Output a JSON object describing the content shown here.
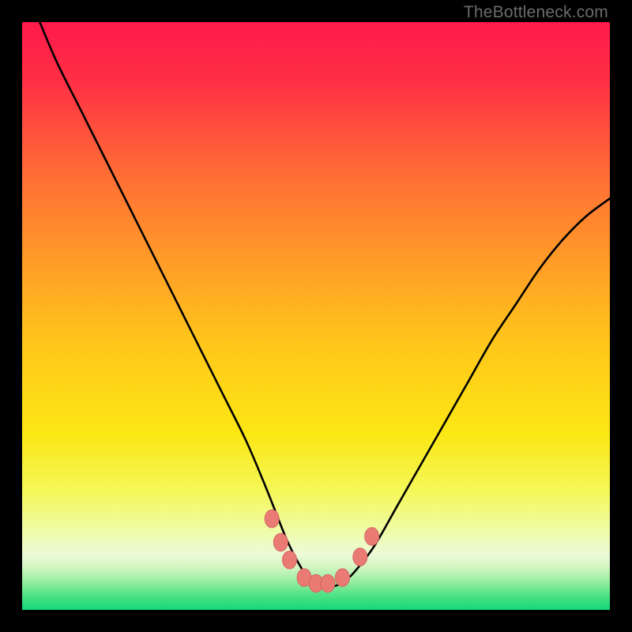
{
  "watermark": "TheBottleneck.com",
  "colors": {
    "black": "#000000",
    "curve": "#000000",
    "marker_fill": "#e97a74",
    "marker_stroke": "#d66761",
    "gradient_stops": [
      {
        "offset": 0.0,
        "color": "#ff1a4b"
      },
      {
        "offset": 0.1,
        "color": "#ff2f45"
      },
      {
        "offset": 0.25,
        "color": "#ff6a36"
      },
      {
        "offset": 0.4,
        "color": "#ff9a28"
      },
      {
        "offset": 0.55,
        "color": "#ffc71a"
      },
      {
        "offset": 0.7,
        "color": "#fbe714"
      },
      {
        "offset": 0.8,
        "color": "#f4f85a"
      },
      {
        "offset": 0.87,
        "color": "#eefcad"
      },
      {
        "offset": 0.905,
        "color": "#ecfad8"
      },
      {
        "offset": 0.925,
        "color": "#d7f6c5"
      },
      {
        "offset": 0.95,
        "color": "#9ceea4"
      },
      {
        "offset": 0.975,
        "color": "#4fe287"
      },
      {
        "offset": 1.0,
        "color": "#14d877"
      }
    ]
  },
  "chart_data": {
    "type": "line",
    "title": "",
    "xlabel": "",
    "ylabel": "",
    "xlim": [
      0,
      100
    ],
    "ylim": [
      0,
      100
    ],
    "series": [
      {
        "name": "bottleneck-curve",
        "x": [
          3,
          6,
          10,
          14,
          18,
          22,
          26,
          30,
          34,
          38,
          41,
          43,
          45,
          47,
          49,
          51,
          53,
          55,
          57,
          60,
          64,
          68,
          72,
          76,
          80,
          84,
          88,
          92,
          96,
          100
        ],
        "y": [
          100,
          93,
          85,
          77,
          69,
          61,
          53,
          45,
          37,
          29,
          22,
          17,
          12,
          8,
          5,
          4,
          4,
          5,
          7,
          11,
          18,
          25,
          32,
          39,
          46,
          52,
          58,
          63,
          67,
          70
        ]
      }
    ],
    "markers": [
      {
        "x": 42.5,
        "y": 15.5
      },
      {
        "x": 44.0,
        "y": 11.5
      },
      {
        "x": 45.5,
        "y": 8.5
      },
      {
        "x": 48.0,
        "y": 5.5
      },
      {
        "x": 50.0,
        "y": 4.5
      },
      {
        "x": 52.0,
        "y": 4.5
      },
      {
        "x": 54.5,
        "y": 5.5
      },
      {
        "x": 57.5,
        "y": 9.0
      },
      {
        "x": 59.5,
        "y": 12.5
      }
    ],
    "marker_radius_px": 9
  }
}
